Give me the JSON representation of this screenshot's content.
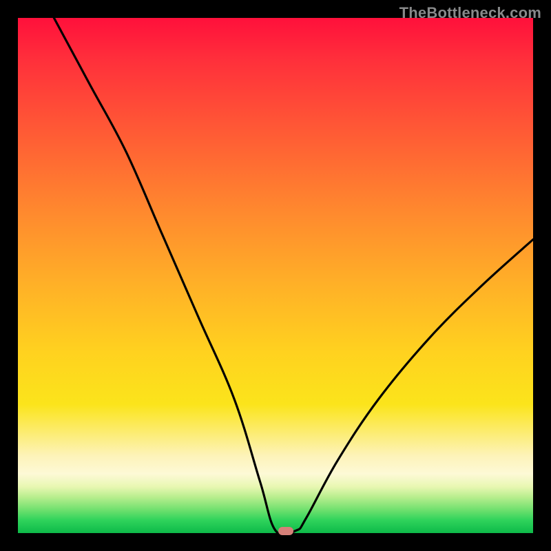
{
  "watermark": "TheBottleneck.com",
  "marker": {
    "x_pct": 52.0,
    "y_pct": 99.6
  },
  "chart_data": {
    "type": "line",
    "title": "",
    "xlabel": "",
    "ylabel": "",
    "xlim": [
      0,
      100
    ],
    "ylim": [
      0,
      100
    ],
    "series": [
      {
        "name": "bottleneck-curve",
        "x": [
          7,
          14,
          21,
          28,
          35,
          42,
          47,
          50,
          54,
          56,
          62,
          70,
          80,
          90,
          100
        ],
        "y": [
          100,
          87,
          74,
          58,
          42,
          26,
          10,
          0.5,
          0.5,
          3,
          14,
          26,
          38,
          48,
          57
        ]
      }
    ],
    "marker_point": {
      "x": 52,
      "y": 0.4
    }
  }
}
